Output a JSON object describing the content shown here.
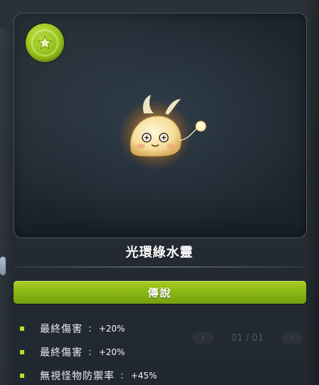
{
  "item": {
    "name": "光環綠水靈",
    "rarity": "傳說",
    "rarity_color": "#8cbc18",
    "badge_icon": "star-icon"
  },
  "stats": [
    {
      "label": "最終傷害",
      "separator": ":",
      "value": "+20%"
    },
    {
      "label": "最終傷害",
      "separator": ":",
      "value": "+20%"
    },
    {
      "label": "無視怪物防禦率",
      "separator": ":",
      "value": "+45%"
    }
  ],
  "background": {
    "pager_text": "01 / 01",
    "prev_arrow": "‹",
    "next_arrow": "›"
  }
}
